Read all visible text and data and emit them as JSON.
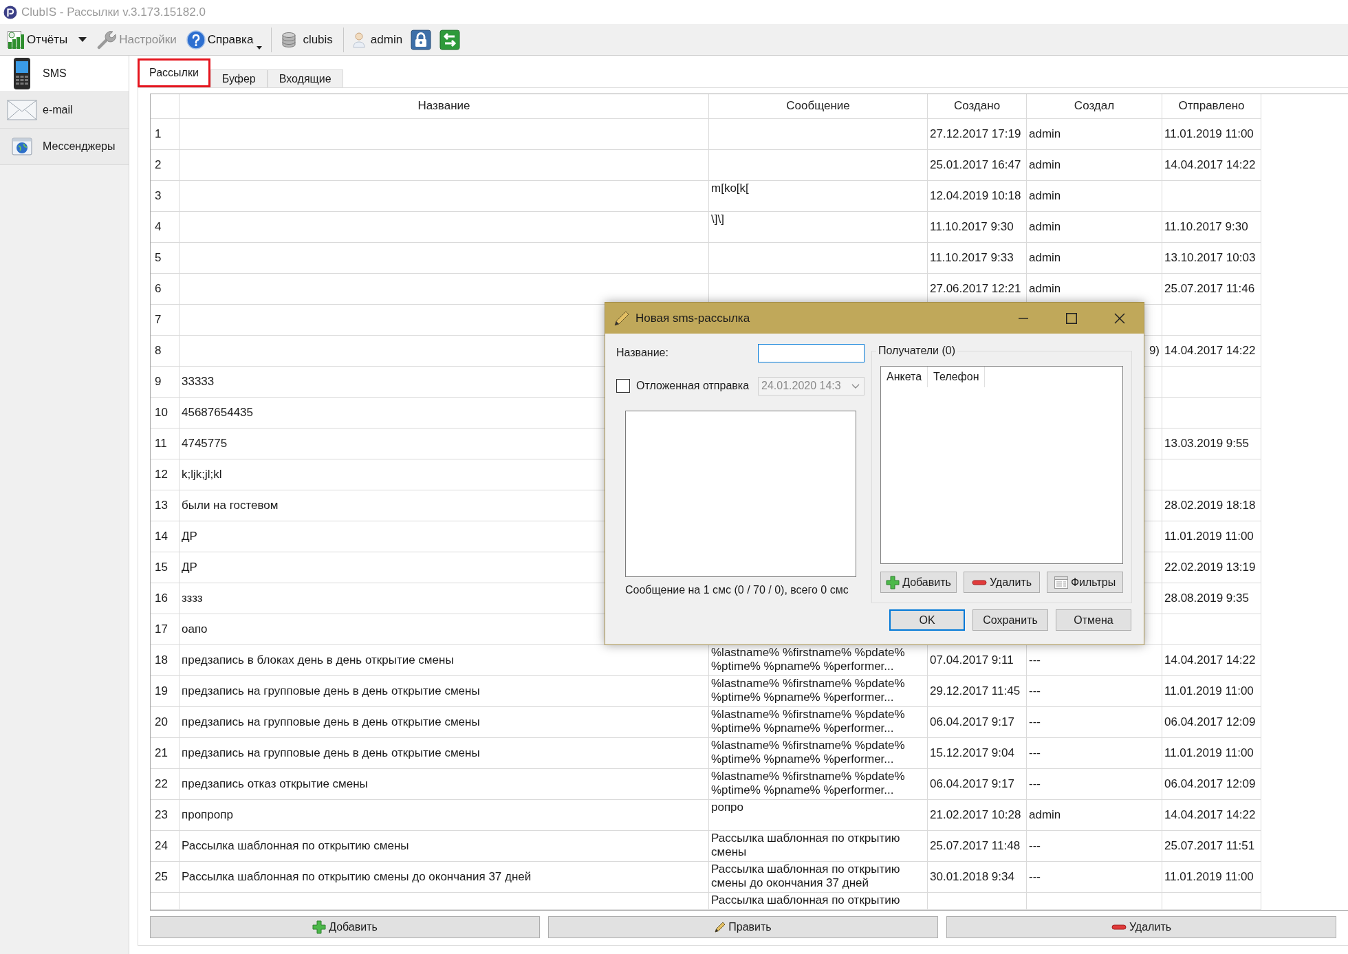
{
  "window": {
    "title": "ClubIS - Рассылки v.3.173.15182.0"
  },
  "toolbar": [
    {
      "kind": "split",
      "label": "Отчёты",
      "disabled": false
    },
    {
      "kind": "button",
      "label": "Настройки",
      "disabled": true
    },
    {
      "kind": "dropdown",
      "label": "Справка",
      "disabled": false
    },
    {
      "kind": "separator"
    },
    {
      "kind": "label",
      "label": "clubis"
    },
    {
      "kind": "separator"
    },
    {
      "kind": "label",
      "label": "admin"
    },
    {
      "kind": "icon",
      "disabled": false
    },
    {
      "kind": "icon",
      "disabled": false
    }
  ],
  "sidebar": [
    {
      "label": "SMS",
      "selected": true
    },
    {
      "label": "e-mail",
      "selected": false
    },
    {
      "label": "Мессенджеры",
      "selected": false
    }
  ],
  "tabs": [
    {
      "label": "Рассылки",
      "selected": true,
      "highlighted": true
    },
    {
      "label": "Буфер",
      "selected": false,
      "highlighted": false
    },
    {
      "label": "Входящие",
      "selected": false,
      "highlighted": false
    }
  ],
  "table": {
    "columns": [
      "Название",
      "Сообщение",
      "Создано",
      "Создал",
      "Отправлено"
    ],
    "rows": [
      {
        "number": "1",
        "created": "27.12.2017 17:19",
        "author": "admin",
        "sent": "11.01.2019 11:00"
      },
      {
        "number": "2",
        "created": "25.01.2017 16:47",
        "author": "admin",
        "sent": "14.04.2017 14:22"
      },
      {
        "number": "3",
        "message": "m[ko[k[",
        "created": "12.04.2019 10:18",
        "author": "admin"
      },
      {
        "number": "4",
        "message": "\\]\\]",
        "created": "11.10.2017 9:30",
        "author": "admin",
        "sent": "11.10.2017 9:30"
      },
      {
        "number": "5",
        "created": "11.10.2017 9:33",
        "author": "admin",
        "sent": "13.10.2017 10:03"
      },
      {
        "number": "6",
        "created": "27.06.2017 12:21",
        "author": "admin",
        "sent": "25.07.2017 11:46"
      },
      {
        "number": "7"
      },
      {
        "number": "8",
        "author": "9)",
        "author_right_aligned": true,
        "sent": "14.04.2017 14:22"
      },
      {
        "number": "9",
        "name": "33333"
      },
      {
        "number": "10",
        "name": "45687654435"
      },
      {
        "number": "11",
        "name": "4745775",
        "sent": "13.03.2019 9:55"
      },
      {
        "number": "12",
        "name": "k;ljk;jl;kl"
      },
      {
        "number": "13",
        "name": "были на гостевом",
        "sent": "28.02.2019 18:18"
      },
      {
        "number": "14",
        "name": "ДР",
        "sent": "11.01.2019 11:00"
      },
      {
        "number": "15",
        "name": "ДР",
        "sent": "22.02.2019 13:19"
      },
      {
        "number": "16",
        "name": "зззз",
        "sent": "28.08.2019 9:35"
      },
      {
        "number": "17",
        "name": "оапо"
      },
      {
        "number": "18",
        "name": "предзапись в блоках день в день открытие смены",
        "message": "%lastname% %firstname% %pdate% %ptime% %pname% %performer...",
        "created": "07.04.2017 9:11",
        "author": "---",
        "sent": "14.04.2017 14:22"
      },
      {
        "number": "19",
        "name": "предзапись на групповые день в день открытие смены",
        "message": "%lastname% %firstname% %pdate% %ptime% %pname% %performer...",
        "created": "29.12.2017 11:45",
        "author": "---",
        "sent": "11.01.2019 11:00"
      },
      {
        "number": "20",
        "name": "предзапись на групповые день в день открытие смены",
        "message": "%lastname% %firstname% %pdate% %ptime% %pname% %performer...",
        "created": "06.04.2017 9:17",
        "author": "---",
        "sent": "06.04.2017 12:09"
      },
      {
        "number": "21",
        "name": "предзапись на групповые день в день открытие смены",
        "message": "%lastname% %firstname% %pdate% %ptime% %pname% %performer...",
        "created": "15.12.2017 9:04",
        "author": "---",
        "sent": "11.01.2019 11:00"
      },
      {
        "number": "22",
        "name": "предзапись отказ открытие смены",
        "message": "%lastname% %firstname% %pdate% %ptime% %pname% %performer...",
        "created": "06.04.2017 9:17",
        "author": "---",
        "sent": "06.04.2017 12:09"
      },
      {
        "number": "23",
        "name": "пропропр",
        "message": "ропро",
        "created": "21.02.2017 10:28",
        "author": "admin",
        "sent": "14.04.2017 14:22"
      },
      {
        "number": "24",
        "name": "Рассылка шаблонная по открытию смены",
        "message": "Рассылка шаблонная по открытию смены",
        "created": "25.07.2017 11:48",
        "author": "---",
        "sent": "25.07.2017 11:51"
      },
      {
        "number": "25",
        "name": "Рассылка шаблонная по открытию смены до окончания 37 дней",
        "message": "Рассылка шаблонная по открытию смены до окончания 37 дней",
        "created": "30.01.2018 9:34",
        "author": "---",
        "sent": "11.01.2019 11:00"
      },
      {
        "message": "Рассылка шаблонная по открытию"
      }
    ]
  },
  "actions": [
    "Добавить",
    "Править",
    "Удалить"
  ],
  "dialog": {
    "title": "Новая sms-рассылка",
    "name_field": {
      "label": "Название:",
      "focused": true
    },
    "deferred": {
      "label": "Отложенная отправка",
      "checked": false
    },
    "date_field": {
      "value": "24.01.2020 14:3",
      "disabled": true
    },
    "message_info": "Сообщение на 1 смс (0 / 70 / 0), всего 0 смс",
    "recipients": {
      "title": "Получатели (0)",
      "columns": [
        "Анкета",
        "Телефон"
      ],
      "buttons": [
        "Добавить",
        "Удалить",
        "Фильтры"
      ]
    },
    "buttons": [
      {
        "label": "OK",
        "default": true
      },
      {
        "label": "Сохранить",
        "default": false
      },
      {
        "label": "Отмена",
        "default": false
      }
    ]
  }
}
